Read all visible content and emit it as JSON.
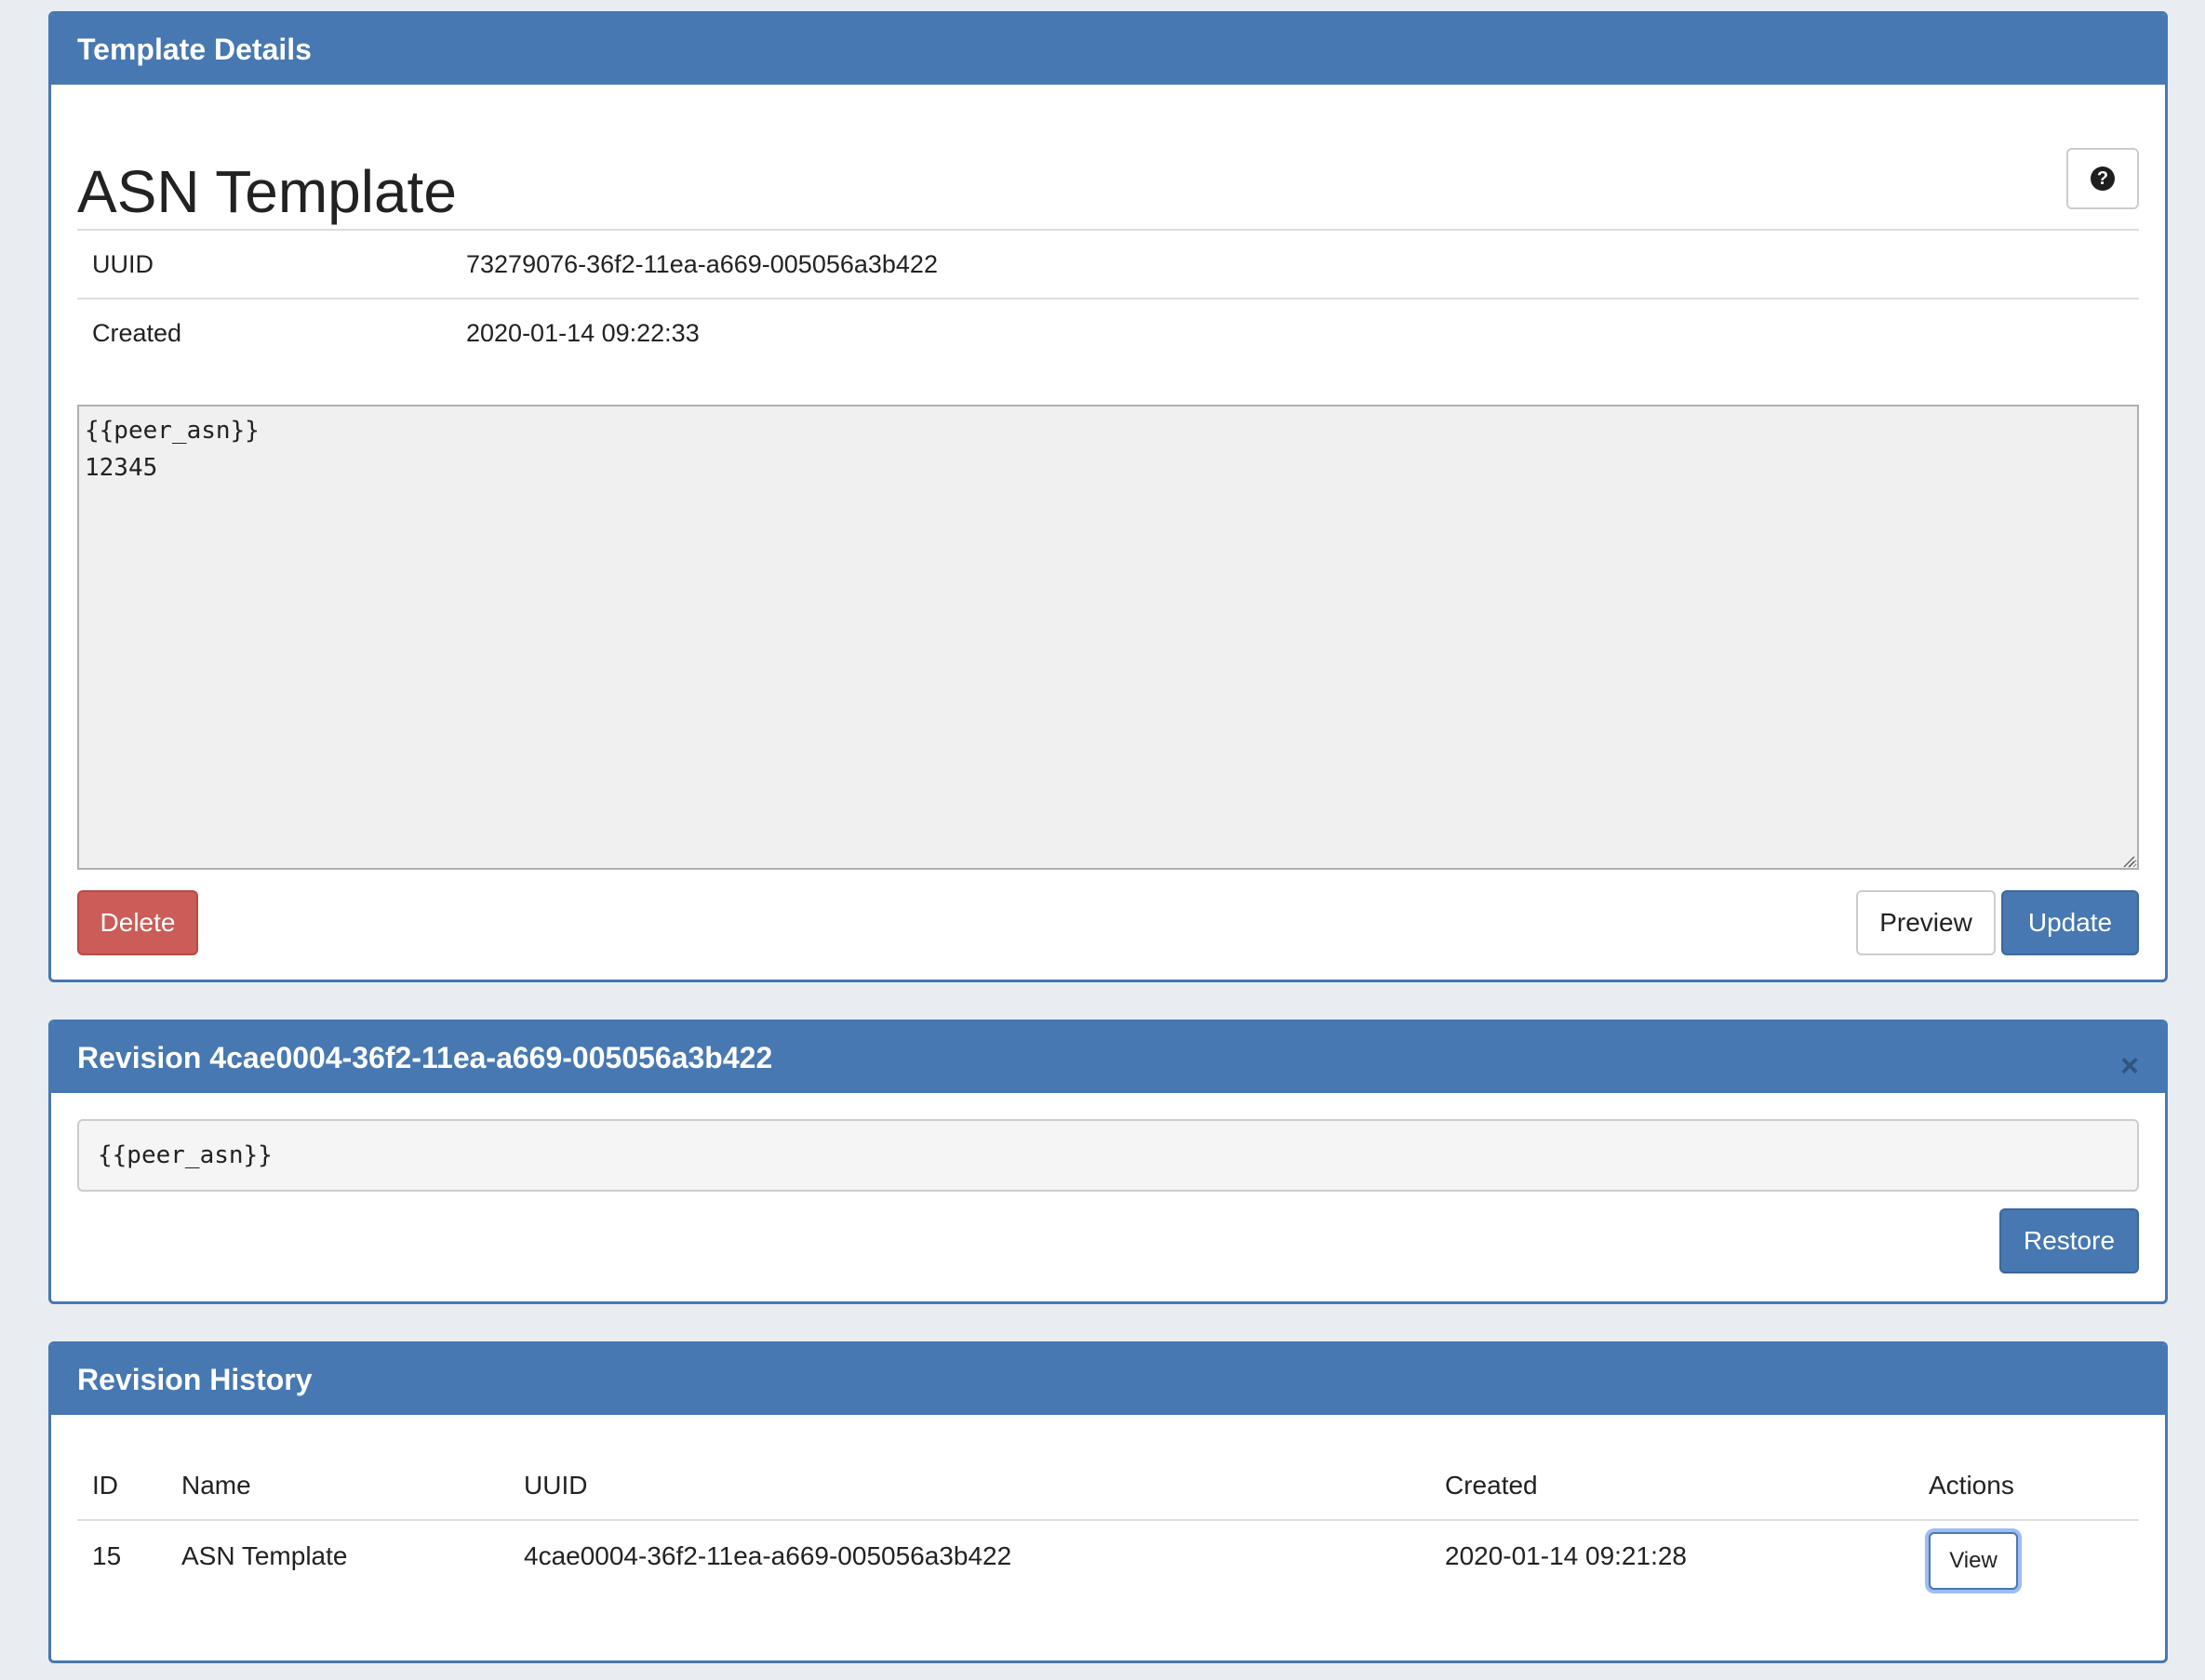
{
  "template_panel": {
    "header": "Template Details",
    "title": "ASN Template",
    "help_icon": "question-circle-icon",
    "meta": [
      {
        "label": "UUID",
        "value": "73279076-36f2-11ea-a669-005056a3b422"
      },
      {
        "label": "Created",
        "value": "2020-01-14 09:22:33"
      }
    ],
    "editor_content": "{{peer_asn}}\n12345",
    "delete_label": "Delete",
    "preview_label": "Preview",
    "update_label": "Update"
  },
  "revision_panel": {
    "header": "Revision 4cae0004-36f2-11ea-a669-005056a3b422",
    "close_symbol": "×",
    "code": "{{peer_asn}}",
    "restore_label": "Restore"
  },
  "history_panel": {
    "header": "Revision History",
    "columns": {
      "id": "ID",
      "name": "Name",
      "uuid": "UUID",
      "created": "Created",
      "actions": "Actions"
    },
    "rows": [
      {
        "id": "15",
        "name": "ASN Template",
        "uuid": "4cae0004-36f2-11ea-a669-005056a3b422",
        "created": "2020-01-14 09:21:28",
        "action_label": "View"
      }
    ]
  },
  "colors": {
    "primary": "#4778b1",
    "danger": "#cc5c57",
    "background": "#e9edf1"
  }
}
